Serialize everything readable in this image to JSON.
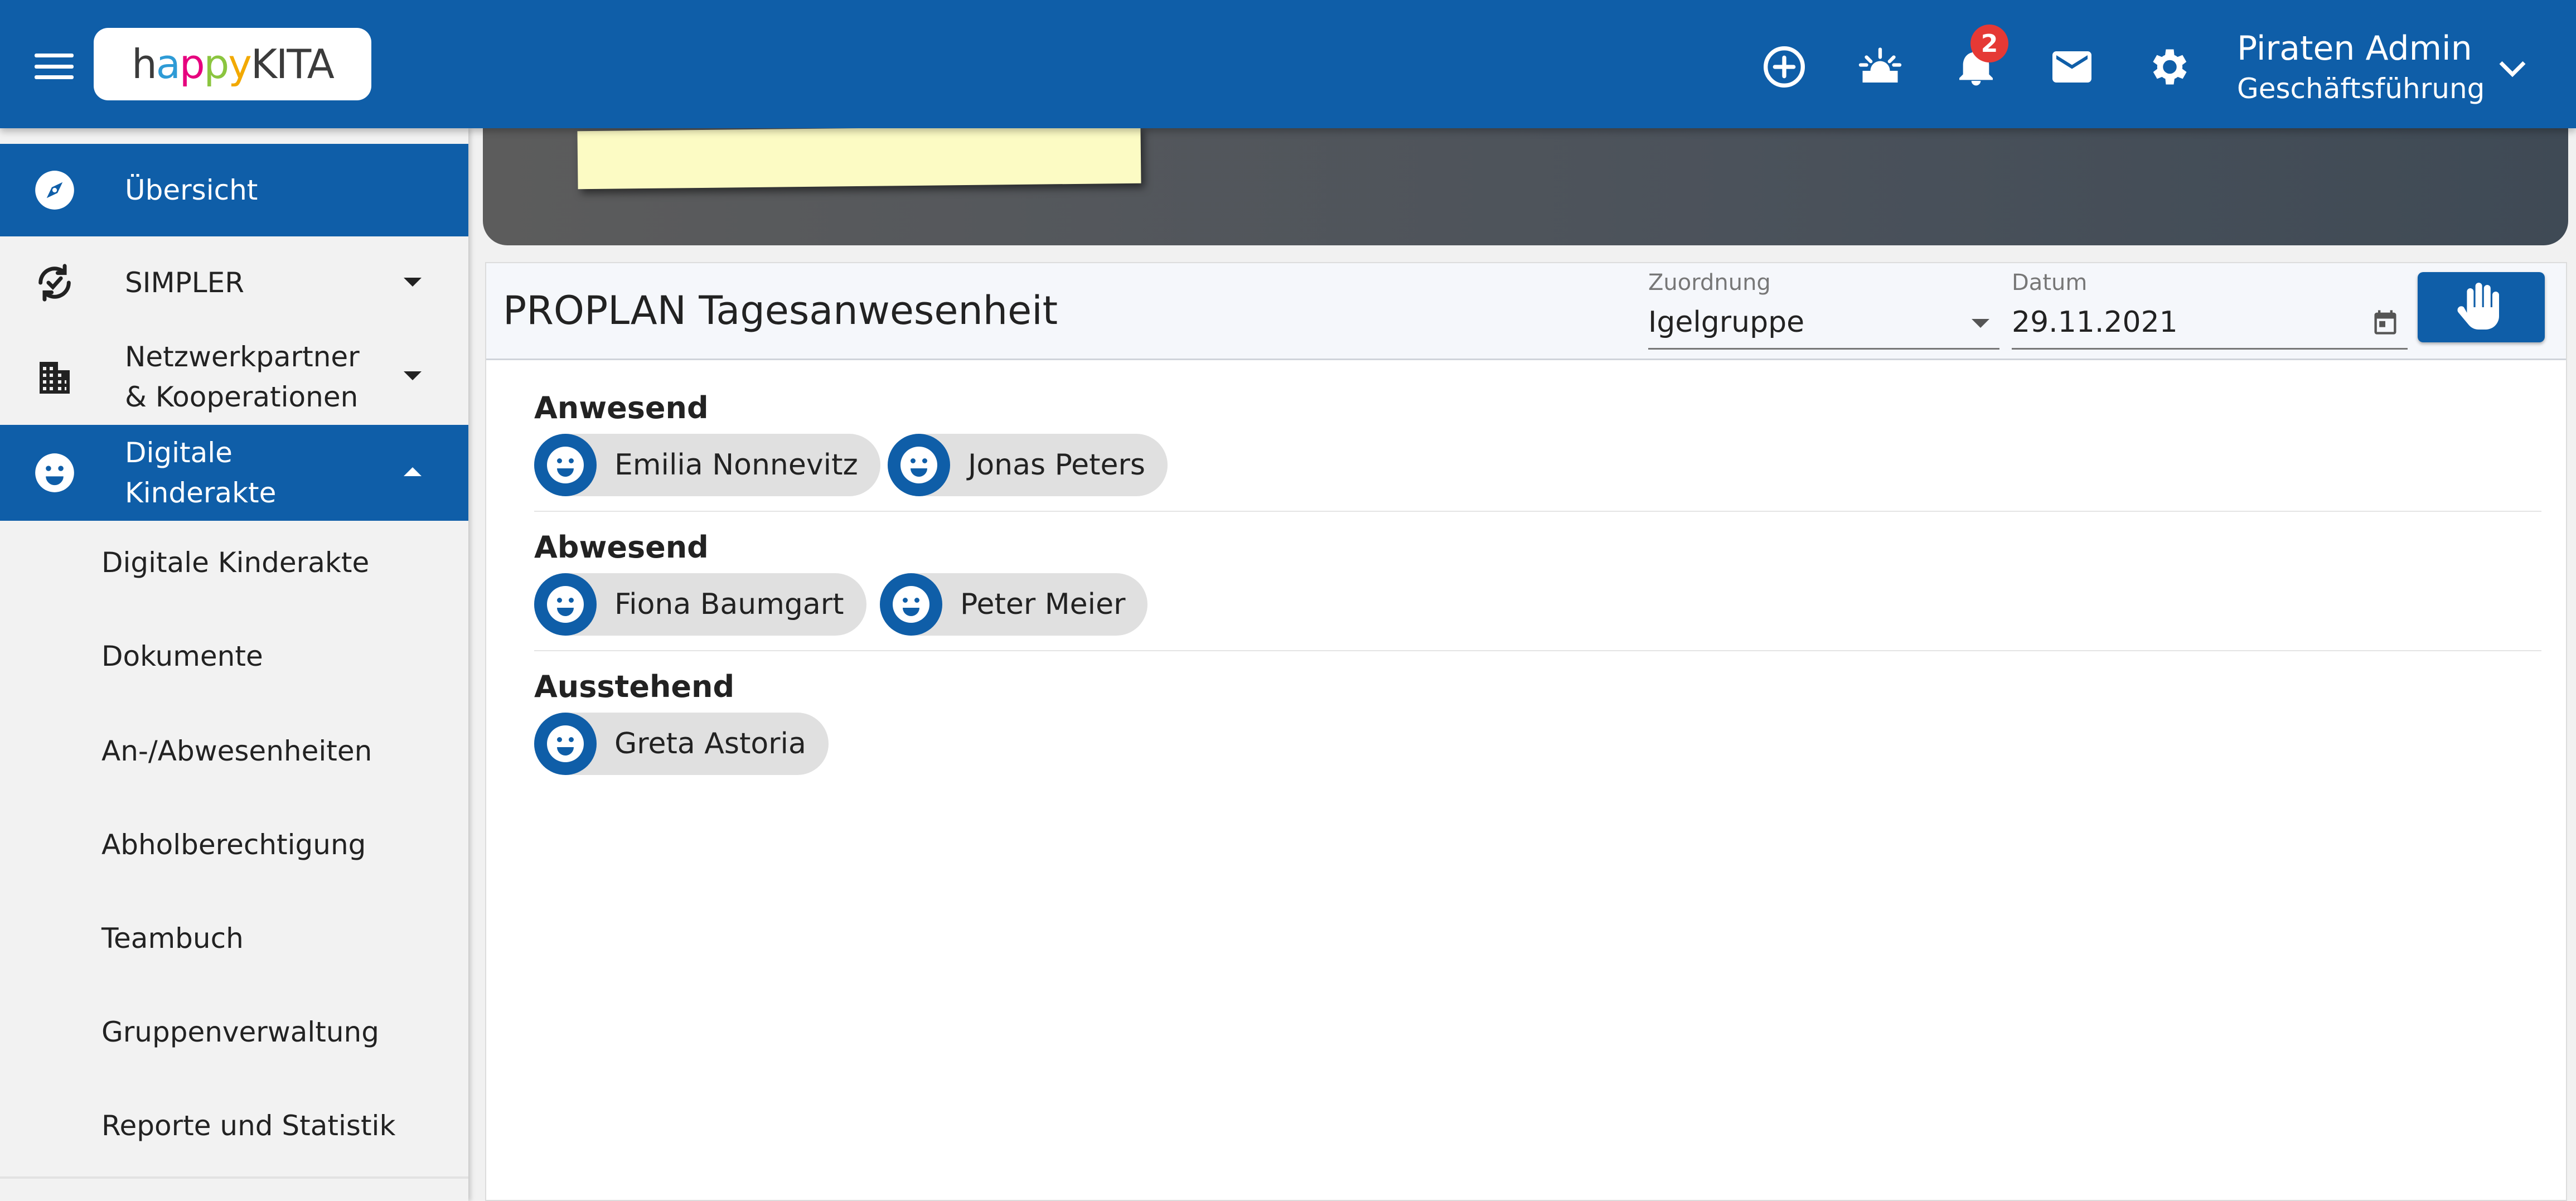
{
  "app": {
    "logo_text": "happyKITA"
  },
  "header": {
    "notification_count": "2",
    "user_name": "Piraten Admin",
    "user_role": "Geschäftsführung",
    "icons": [
      "menu-icon",
      "add-circle-icon",
      "sunrise-icon",
      "bell-icon",
      "mail-icon",
      "gear-icon",
      "chevron-down-icon"
    ]
  },
  "sidebar": {
    "items": [
      {
        "label": "Übersicht",
        "icon": "compass-icon",
        "active": true
      },
      {
        "label": "SIMPLER",
        "icon": "sync-check-icon",
        "expandable": true
      },
      {
        "label_line1": "Netzwerkpartner",
        "label_line2": "& Kooperationen",
        "icon": "building-icon",
        "expandable": true
      },
      {
        "label_line1": "Digitale",
        "label_line2": "Kinderakte",
        "icon": "smiley-icon",
        "active": true,
        "expanded": true
      }
    ],
    "subitems": [
      "Digitale Kinderakte",
      "Dokumente",
      "An-/Abwesenheiten",
      "Abholberechtigung",
      "Teambuch",
      "Gruppenverwaltung",
      "Reporte und Statistik"
    ]
  },
  "main": {
    "title": "PROPLAN Tagesanwesenheit",
    "assignment": {
      "label": "Zuordnung",
      "value": "Igelgruppe"
    },
    "date": {
      "label": "Datum",
      "value": "29.11.2021"
    },
    "sections": [
      {
        "title": "Anwesend",
        "children": [
          "Emilia Nonnevitz",
          "Jonas Peters"
        ]
      },
      {
        "title": "Abwesend",
        "children": [
          "Fiona Baumgart",
          "Peter Meier"
        ]
      },
      {
        "title": "Ausstehend",
        "children": [
          "Greta Astoria"
        ]
      }
    ]
  },
  "colors": {
    "primary": "#0f5ea8",
    "badge": "#e53935",
    "chip": "#e0e0e0"
  }
}
